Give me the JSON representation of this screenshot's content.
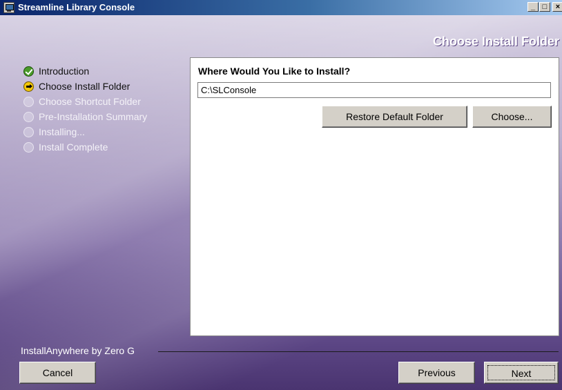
{
  "window": {
    "title": "Streamline Library Console",
    "controls": {
      "minimize": "_",
      "maximize": "□",
      "close": "×"
    }
  },
  "heading": "Choose Install Folder",
  "steps": [
    {
      "label": "Introduction",
      "state": "done"
    },
    {
      "label": "Choose Install Folder",
      "state": "current"
    },
    {
      "label": "Choose Shortcut Folder",
      "state": "pending"
    },
    {
      "label": "Pre-Installation Summary",
      "state": "pending"
    },
    {
      "label": "Installing...",
      "state": "pending"
    },
    {
      "label": "Install Complete",
      "state": "pending"
    }
  ],
  "panel": {
    "question": "Where Would You Like to Install?",
    "install_path": "C:\\SLConsole",
    "restore_default_label": "Restore Default Folder",
    "choose_label": "Choose..."
  },
  "footer": {
    "brand": "InstallAnywhere by Zero G",
    "cancel_label": "Cancel",
    "previous_label": "Previous",
    "next_label": "Next"
  },
  "colors": {
    "title_bar": "#0a246a",
    "background_purple": "#8e7caf",
    "button_face": "#d4d0c8",
    "done_icon": "#4a9a2a",
    "current_icon": "#f2c60a"
  }
}
